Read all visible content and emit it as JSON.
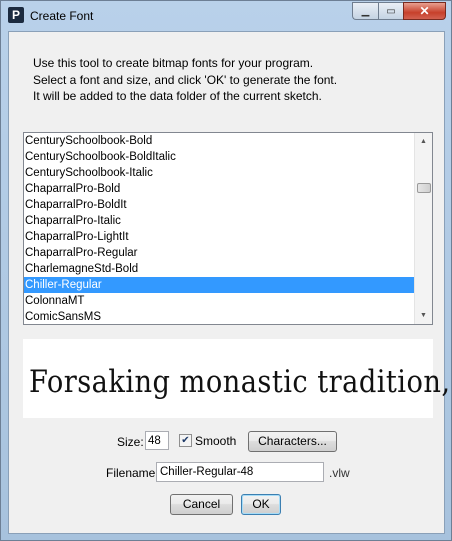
{
  "window": {
    "title": "Create Font",
    "app_icon_letter": "P",
    "minimize_glyph": "▁",
    "maximize_glyph": "▭",
    "close_glyph": "✕"
  },
  "intro": {
    "line1": "Use this tool to create bitmap fonts for your program.",
    "line2": "Select a font and size, and click 'OK' to generate the font.",
    "line3": "It will be added to the data folder of the current sketch."
  },
  "font_list": {
    "items": [
      "CenturySchoolbook-Bold",
      "CenturySchoolbook-BoldItalic",
      "CenturySchoolbook-Italic",
      "ChaparralPro-Bold",
      "ChaparralPro-BoldIt",
      "ChaparralPro-Italic",
      "ChaparralPro-LightIt",
      "ChaparralPro-Regular",
      "CharlemagneStd-Bold",
      "Chiller-Regular",
      "ColonnaMT",
      "ComicSansMS"
    ],
    "selected": "Chiller-Regular"
  },
  "preview": {
    "text": "Forsaking monastic tradition,"
  },
  "controls": {
    "size_label": "Size:",
    "size_value": "48",
    "smooth_label": "Smooth",
    "smooth_checked": true,
    "characters_button": "Characters...",
    "filename_label": "Filename:",
    "filename_value": "Chiller-Regular-48",
    "extension": ".vlw",
    "cancel_button": "Cancel",
    "ok_button": "OK"
  },
  "colors": {
    "selection": "#3399ff",
    "client_bg": "#f0f0f0",
    "close_button": "#c7402b"
  }
}
